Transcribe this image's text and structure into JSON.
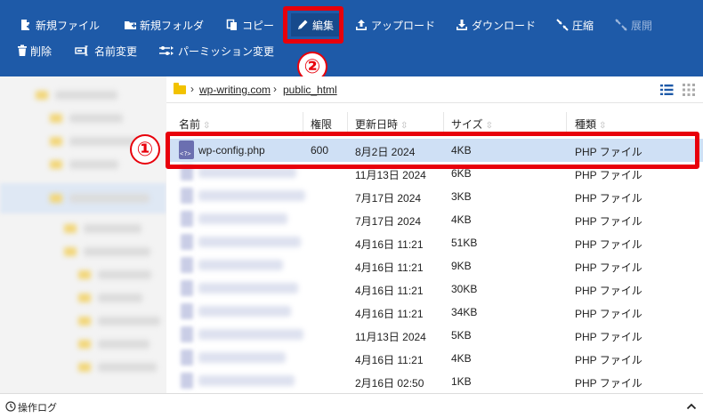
{
  "toolbar": {
    "row1": [
      {
        "label": "新規ファイル",
        "icon": "new-file-icon"
      },
      {
        "label": "新規フォルダ",
        "icon": "new-folder-icon"
      },
      {
        "label": "コピー",
        "icon": "copy-icon"
      },
      {
        "label": "編集",
        "icon": "pencil-icon"
      },
      {
        "label": "アップロード",
        "icon": "upload-icon"
      },
      {
        "label": "ダウンロード",
        "icon": "download-icon"
      },
      {
        "label": "圧縮",
        "icon": "compress-icon"
      },
      {
        "label": "展開",
        "icon": "extract-icon"
      }
    ],
    "row2": [
      {
        "label": "削除",
        "icon": "trash-icon"
      },
      {
        "label": "名前変更",
        "icon": "rename-icon"
      },
      {
        "label": "パーミッション変更",
        "icon": "permission-icon"
      }
    ]
  },
  "annotations": {
    "step1": "①",
    "step2": "②",
    "color": "#e8000b"
  },
  "breadcrumb": [
    "wp-writing.com",
    "public_html"
  ],
  "breadcrumb_sep": "›",
  "table": {
    "headers": [
      "名前",
      "権限",
      "更新日時",
      "サイズ",
      "種類"
    ],
    "sort_glyph": "⇳",
    "rows": [
      {
        "name": "wp-config.php",
        "perm": "600",
        "date": "8月2日 2024",
        "size": "4KB",
        "type": "PHP ファイル"
      },
      {
        "name": "",
        "perm": "",
        "date": "11月13日 2024",
        "size": "6KB",
        "type": "PHP ファイル"
      },
      {
        "name": "",
        "perm": "",
        "date": "7月17日 2024",
        "size": "3KB",
        "type": "PHP ファイル"
      },
      {
        "name": "",
        "perm": "",
        "date": "7月17日 2024",
        "size": "4KB",
        "type": "PHP ファイル"
      },
      {
        "name": "",
        "perm": "",
        "date": "4月16日 11:21",
        "size": "51KB",
        "type": "PHP ファイル"
      },
      {
        "name": "",
        "perm": "",
        "date": "4月16日 11:21",
        "size": "9KB",
        "type": "PHP ファイル"
      },
      {
        "name": "",
        "perm": "",
        "date": "4月16日 11:21",
        "size": "30KB",
        "type": "PHP ファイル"
      },
      {
        "name": "",
        "perm": "",
        "date": "4月16日 11:21",
        "size": "34KB",
        "type": "PHP ファイル"
      },
      {
        "name": "",
        "perm": "",
        "date": "11月13日 2024",
        "size": "5KB",
        "type": "PHP ファイル"
      },
      {
        "name": "",
        "perm": "",
        "date": "4月16日 11:21",
        "size": "4KB",
        "type": "PHP ファイル"
      },
      {
        "name": "",
        "perm": "",
        "date": "2月16日 02:50",
        "size": "1KB",
        "type": "PHP ファイル"
      }
    ]
  },
  "footer": {
    "label": "操作ログ",
    "expand_glyph": "⌃"
  },
  "colors": {
    "toolbar": "#1e5aa8",
    "selected_row": "#cfe0f5",
    "highlight": "#e8000b"
  }
}
